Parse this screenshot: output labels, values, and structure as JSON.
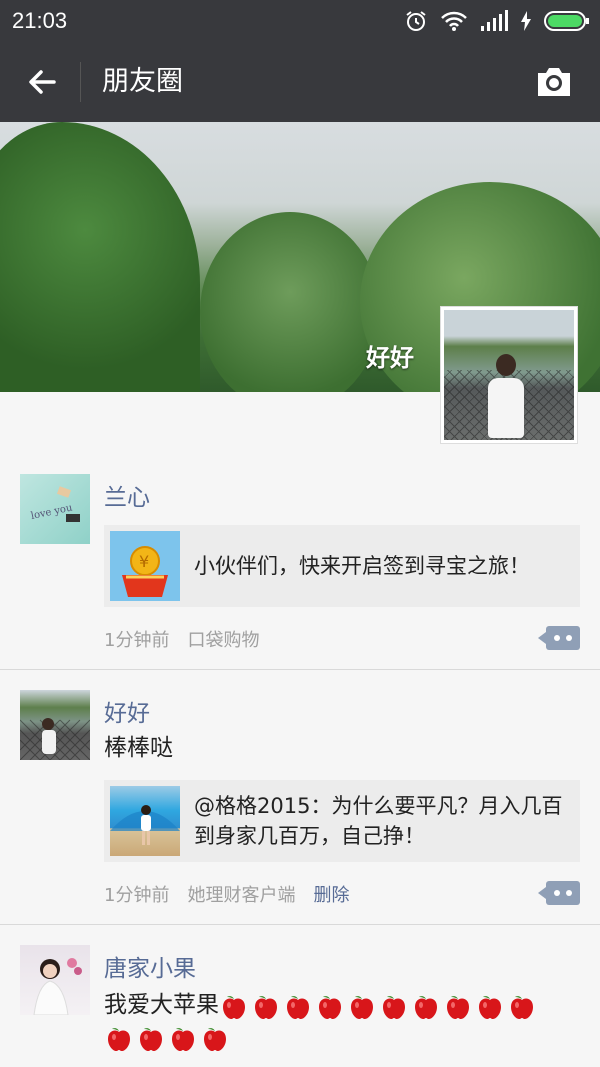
{
  "status_bar": {
    "time": "21:03"
  },
  "app_bar": {
    "title": "朋友圈"
  },
  "cover": {
    "owner_name": "好好"
  },
  "posts": [
    {
      "name": "兰心",
      "link_text": "小伙伴们，快来开启签到寻宝之旅！",
      "time": "1分钟前",
      "source": "口袋购物"
    },
    {
      "name": "好好",
      "text": "棒棒哒",
      "link_text": "@格格2015：为什么要平凡？月入几百到身家几百万，自己挣！",
      "time": "1分钟前",
      "source": "她理财客户端",
      "delete_label": "删除"
    },
    {
      "name": "唐家小果",
      "text": "我爱大苹果"
    }
  ],
  "colors": {
    "bar": "#38393d",
    "name_link": "#576b95",
    "comment_btn": "#8f9fb6"
  }
}
